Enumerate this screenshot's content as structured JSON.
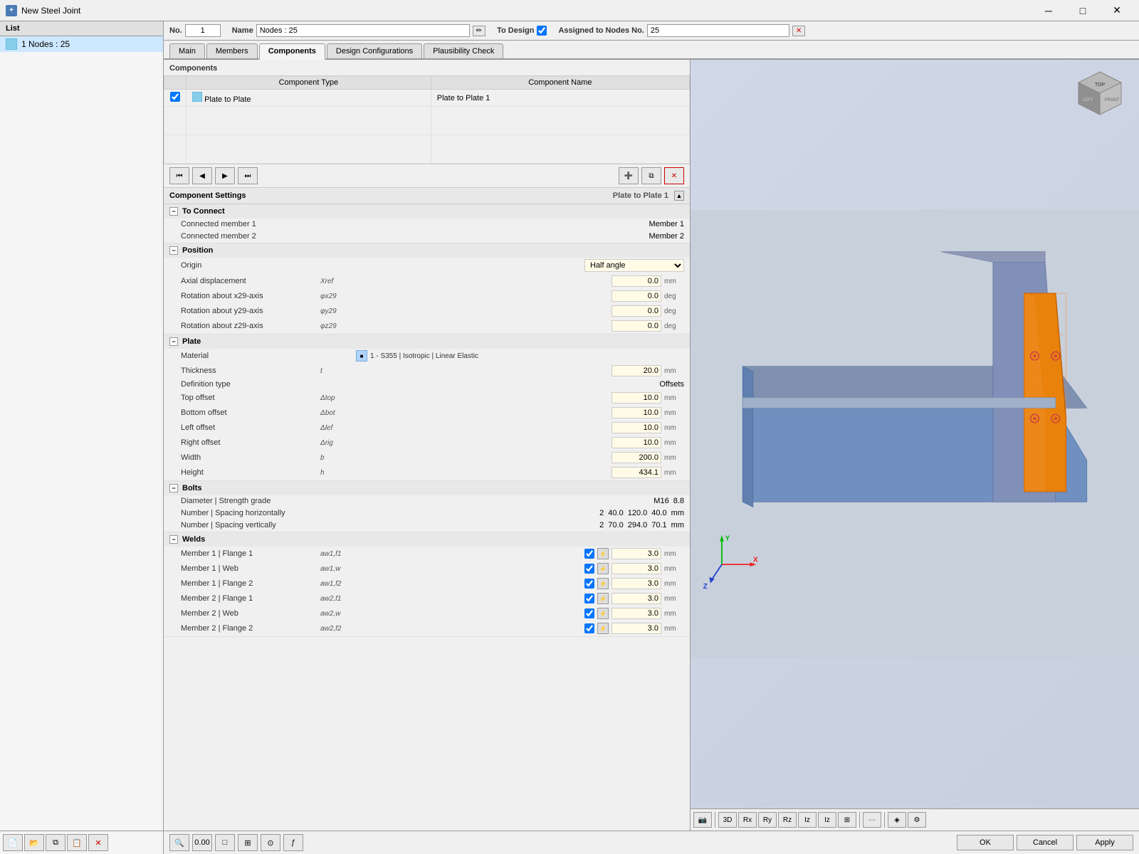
{
  "titleBar": {
    "title": "New Steel Joint",
    "icon": "steel-joint-icon"
  },
  "leftPanel": {
    "header": "List",
    "items": [
      {
        "label": "1  Nodes : 25",
        "selected": true
      }
    ],
    "toolbarBtns": [
      {
        "name": "new-btn",
        "label": "📄"
      },
      {
        "name": "open-btn",
        "label": "📂"
      },
      {
        "name": "duplicate-btn",
        "label": "⧉"
      },
      {
        "name": "paste-btn",
        "label": "📋"
      },
      {
        "name": "delete-btn",
        "label": "✕"
      }
    ]
  },
  "header": {
    "noLabel": "No.",
    "noValue": "1",
    "nameLabel": "Name",
    "nameValue": "Nodes : 25",
    "toDesignLabel": "To Design",
    "toDesignChecked": true,
    "assignedLabel": "Assigned to Nodes No.",
    "assignedValue": "25"
  },
  "tabs": [
    {
      "label": "Main",
      "active": false
    },
    {
      "label": "Members",
      "active": false
    },
    {
      "label": "Components",
      "active": true
    },
    {
      "label": "Design Configurations",
      "active": false
    },
    {
      "label": "Plausibility Check",
      "active": false
    }
  ],
  "components": {
    "sectionTitle": "Components",
    "colHeaders": [
      "Component Type",
      "Component Name"
    ],
    "rows": [
      {
        "checked": true,
        "colorBox": true,
        "type": "Plate to Plate",
        "name": "Plate to Plate 1"
      }
    ],
    "toolbarBtns": [
      {
        "name": "first-btn",
        "label": "⏮"
      },
      {
        "name": "prev-btn",
        "label": "◀"
      },
      {
        "name": "next-btn",
        "label": "▶"
      },
      {
        "name": "last-btn",
        "label": "⏭"
      },
      {
        "name": "add-comp-btn",
        "label": "➕"
      },
      {
        "name": "edit-comp-btn",
        "label": "✏"
      },
      {
        "name": "delete-comp-btn",
        "label": "✕",
        "style": "red"
      }
    ]
  },
  "componentSettings": {
    "title": "Component Settings",
    "subtitle": "Plate to Plate 1",
    "groups": {
      "toConnect": {
        "label": "To Connect",
        "rows": [
          {
            "label": "Connected member 1",
            "sym": "",
            "value": "Member 1"
          },
          {
            "label": "Connected member 2",
            "sym": "",
            "value": "Member 2"
          }
        ]
      },
      "position": {
        "label": "Position",
        "rows": [
          {
            "label": "Origin",
            "sym": "",
            "value": "Half angle",
            "type": "combo"
          },
          {
            "label": "Axial displacement",
            "sym": "Xref",
            "value": "0.0",
            "unit": "mm"
          },
          {
            "label": "Rotation about x29-axis",
            "sym": "φx29",
            "value": "0.0",
            "unit": "deg"
          },
          {
            "label": "Rotation about y29-axis",
            "sym": "φy29",
            "value": "0.0",
            "unit": "deg"
          },
          {
            "label": "Rotation about z29-axis",
            "sym": "φz29",
            "value": "0.0",
            "unit": "deg"
          }
        ]
      },
      "plate": {
        "label": "Plate",
        "rows": [
          {
            "label": "Material",
            "sym": "",
            "value": "1 - S355 | Isotropic | Linear Elastic",
            "type": "material"
          },
          {
            "label": "Thickness",
            "sym": "t",
            "value": "20.0",
            "unit": "mm"
          },
          {
            "label": "Definition type",
            "sym": "",
            "value": "Offsets",
            "type": "static"
          },
          {
            "label": "Top offset",
            "sym": "Δtop",
            "value": "10.0",
            "unit": "mm"
          },
          {
            "label": "Bottom offset",
            "sym": "Δbot",
            "value": "10.0",
            "unit": "mm"
          },
          {
            "label": "Left offset",
            "sym": "Δlef",
            "value": "10.0",
            "unit": "mm"
          },
          {
            "label": "Right offset",
            "sym": "Δrig",
            "value": "10.0",
            "unit": "mm"
          },
          {
            "label": "Width",
            "sym": "b",
            "value": "200.0",
            "unit": "mm"
          },
          {
            "label": "Height",
            "sym": "h",
            "value": "434.1",
            "unit": "mm"
          }
        ]
      },
      "bolts": {
        "label": "Bolts",
        "rows": [
          {
            "label": "Diameter | Strength grade",
            "sym": "",
            "values": [
              "M16",
              "8.8"
            ],
            "type": "bolt-grade"
          },
          {
            "label": "Number | Spacing horizontally",
            "sym": "",
            "values": [
              "2",
              "40.0",
              "120.0",
              "40.0"
            ],
            "unit": "mm",
            "type": "bolt-spacing"
          },
          {
            "label": "Number | Spacing vertically",
            "sym": "",
            "values": [
              "2",
              "70.0",
              "294.0",
              "70.1"
            ],
            "unit": "mm",
            "type": "bolt-spacing"
          }
        ]
      },
      "welds": {
        "label": "Welds",
        "rows": [
          {
            "label": "Member 1 | Flange 1",
            "sym": "aw1,f1",
            "checked": true,
            "value": "3.0",
            "unit": "mm"
          },
          {
            "label": "Member 1 | Web",
            "sym": "aw1,w",
            "checked": true,
            "value": "3.0",
            "unit": "mm"
          },
          {
            "label": "Member 1 | Flange 2",
            "sym": "aw1,f2",
            "checked": true,
            "value": "3.0",
            "unit": "mm"
          },
          {
            "label": "Member 2 | Flange 1",
            "sym": "aw2,f1",
            "checked": true,
            "value": "3.0",
            "unit": "mm"
          },
          {
            "label": "Member 2 | Web",
            "sym": "aw2,w",
            "checked": true,
            "value": "3.0",
            "unit": "mm"
          },
          {
            "label": "Member 2 | Flange 2",
            "sym": "aw2,f2",
            "checked": true,
            "value": "3.0",
            "unit": "mm"
          }
        ]
      }
    }
  },
  "viewPanel": {
    "cubeLabel": "3D Navigation Cube"
  },
  "bottomBar": {
    "toolBtns": [
      "🔍",
      "0.00",
      "□",
      "⊞",
      "⊙",
      "ƒ"
    ],
    "actionBtns": [
      {
        "name": "ok-btn",
        "label": "OK"
      },
      {
        "name": "cancel-btn",
        "label": "Cancel"
      },
      {
        "name": "apply-btn",
        "label": "Apply"
      }
    ]
  }
}
